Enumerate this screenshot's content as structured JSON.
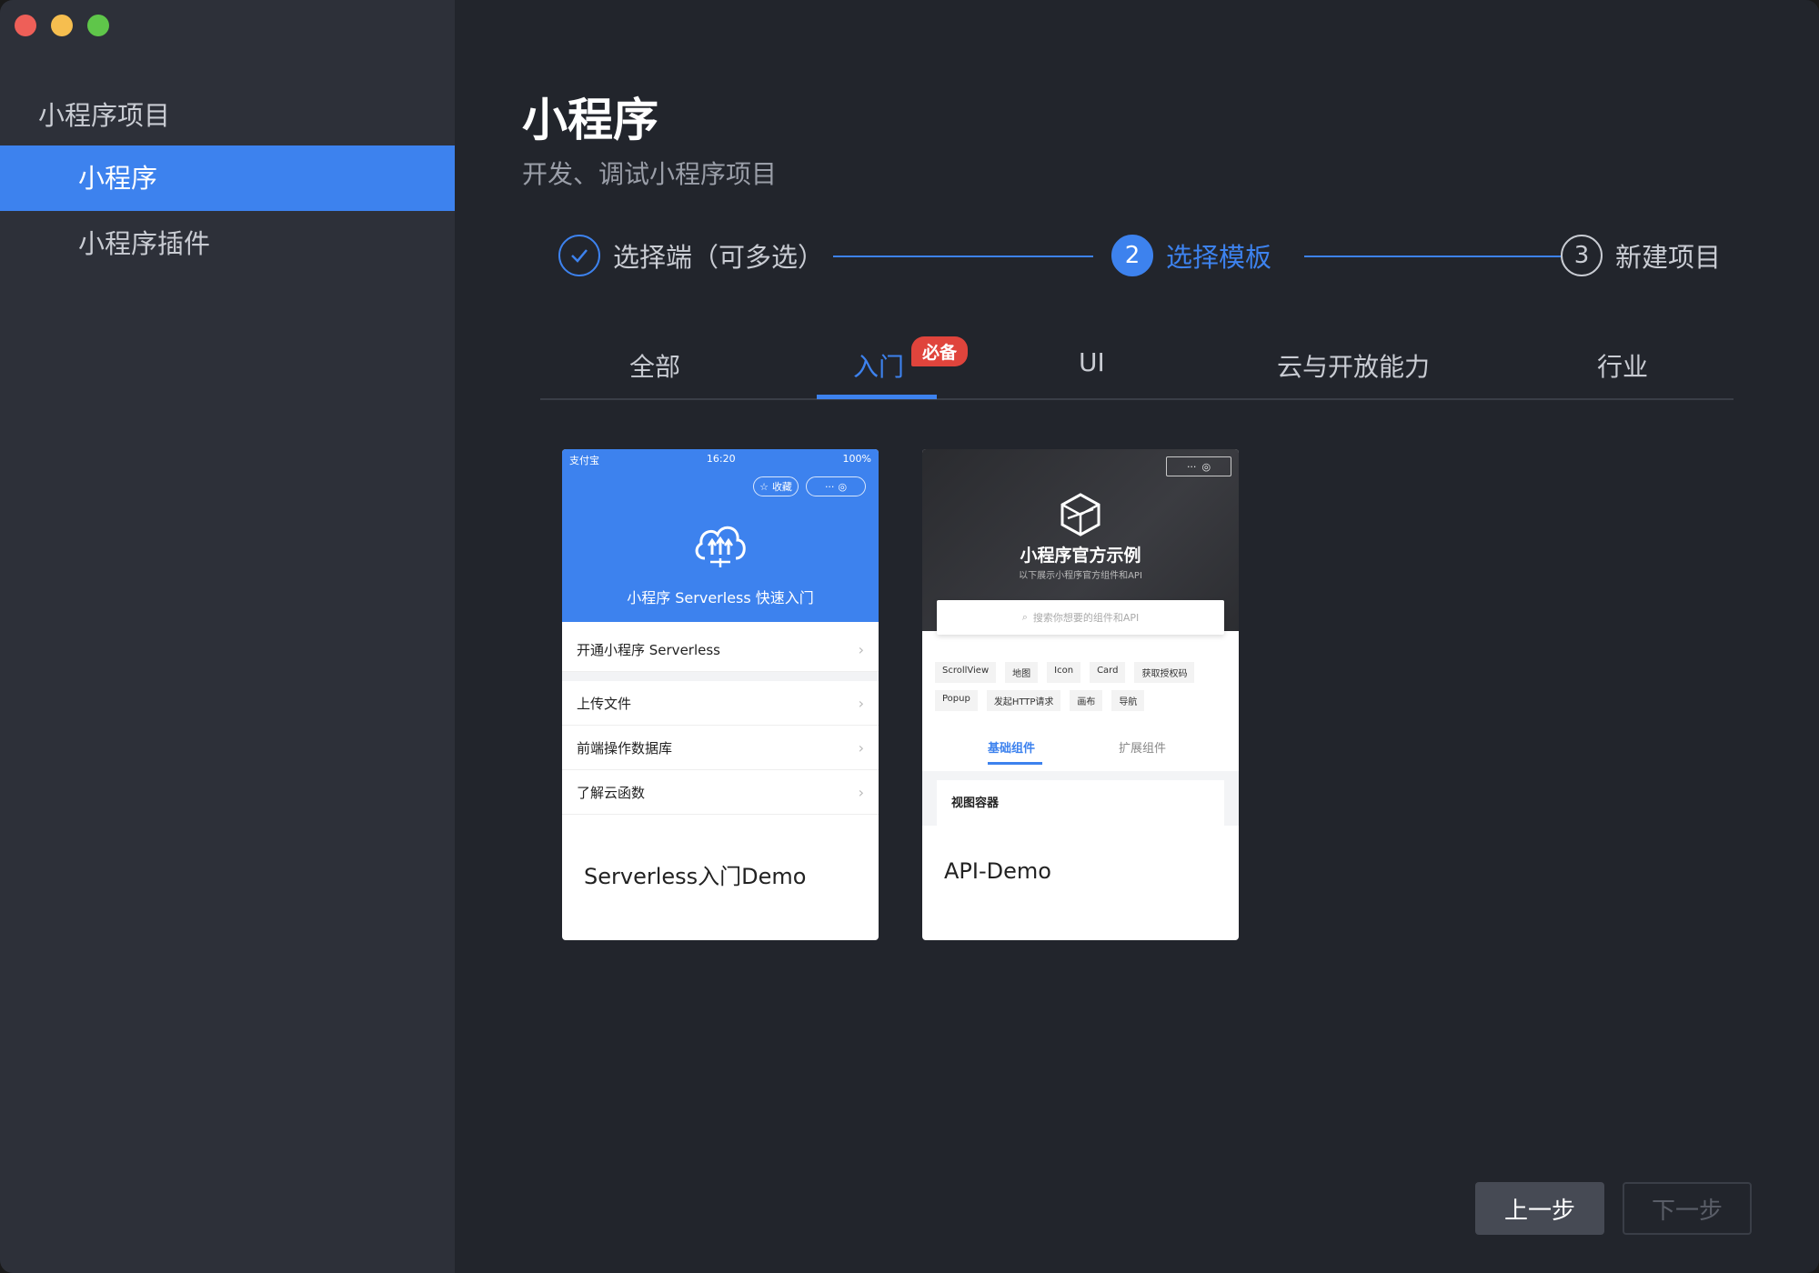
{
  "sidebar": {
    "section_title": "小程序项目",
    "items": [
      {
        "label": "小程序",
        "active": true
      },
      {
        "label": "小程序插件",
        "active": false
      }
    ]
  },
  "header": {
    "title": "小程序",
    "subtitle": "开发、调试小程序项目"
  },
  "steps": [
    {
      "number": "✓",
      "label": "选择端（可多选）",
      "state": "done"
    },
    {
      "number": "2",
      "label": "选择模板",
      "state": "active"
    },
    {
      "number": "3",
      "label": "新建项目",
      "state": "pending"
    }
  ],
  "tabs": [
    {
      "label": "全部"
    },
    {
      "label": "入门",
      "badge": "必备",
      "active": true
    },
    {
      "label": "UI"
    },
    {
      "label": "云与开放能力"
    },
    {
      "label": "行业"
    }
  ],
  "templates": [
    {
      "label": "Serverless入门Demo",
      "preview": {
        "status_left": "支付宝",
        "status_time": "16:20",
        "status_battery": "100%",
        "fav_label": "收藏",
        "title": "小程序 Serverless 快速入门",
        "rows": [
          "开通小程序 Serverless",
          "上传文件",
          "前端操作数据库",
          "了解云函数"
        ]
      }
    },
    {
      "label": "API-Demo",
      "preview": {
        "title": "小程序官方示例",
        "subtitle": "以下展示小程序官方组件和API",
        "search_placeholder": "搜索你想要的组件和API",
        "tags": [
          "ScrollView",
          "地图",
          "Icon",
          "Card",
          "获取授权码",
          "Popup",
          "发起HTTP请求",
          "画布",
          "导航"
        ],
        "tab_active": "基础组件",
        "tab_other": "扩展组件",
        "section": "视图容器"
      }
    }
  ],
  "buttons": {
    "prev": "上一步",
    "next": "下一步"
  },
  "colors": {
    "accent": "#3d82ee",
    "sidebar_bg": "#2d3039",
    "main_bg": "#22252c",
    "badge": "#e0443c"
  },
  "icons": {
    "step_done": "check-circle-icon",
    "chevron": "chevron-right-icon",
    "cloud": "cloud-upload-icon",
    "logo": "cube-logo-icon"
  }
}
